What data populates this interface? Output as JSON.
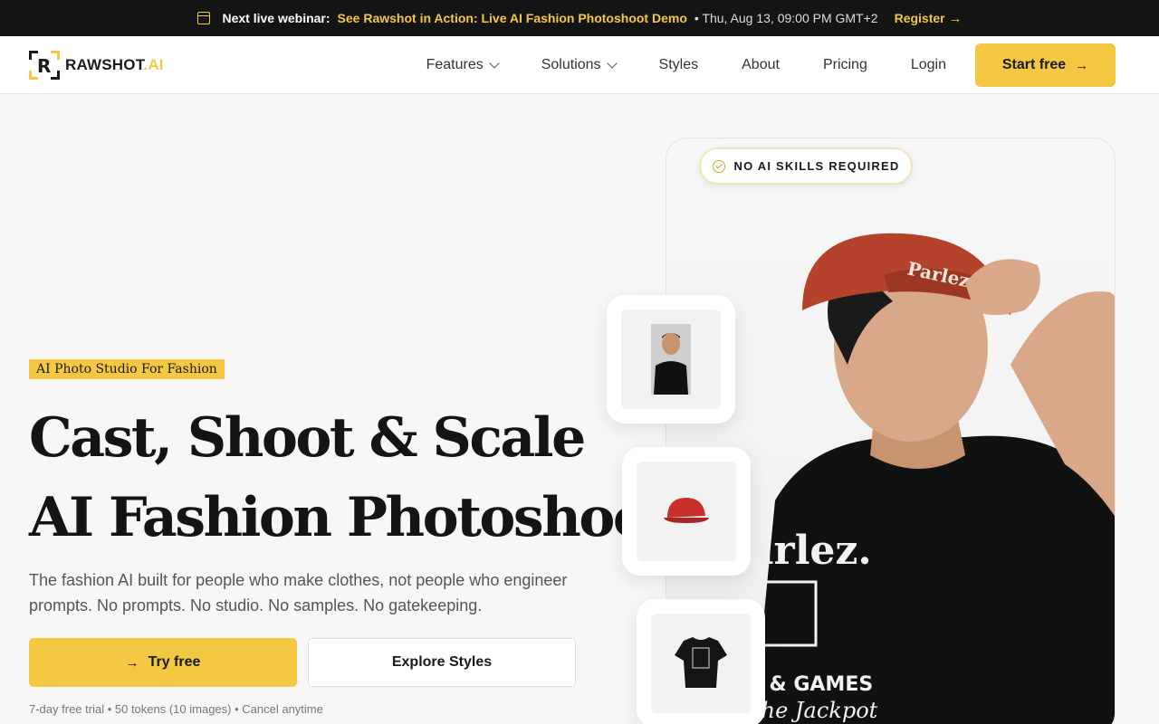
{
  "announcement": {
    "prefix": "Next live webinar:",
    "title": "See Rawshot in Action: Live AI Fashion Photoshoot Demo",
    "date": "• Thu, Aug 13, 09:00 PM GMT+2",
    "register": "Register"
  },
  "nav": {
    "logo_text": "RAWSHOT",
    "logo_suffix": ".AI",
    "items": [
      {
        "label": "Features",
        "dropdown": true
      },
      {
        "label": "Solutions",
        "dropdown": true
      },
      {
        "label": "Styles",
        "dropdown": false
      },
      {
        "label": "About",
        "dropdown": false
      },
      {
        "label": "Pricing",
        "dropdown": false
      },
      {
        "label": "Login",
        "dropdown": false
      }
    ],
    "cta": "Start free"
  },
  "hero": {
    "badge": "AI Photo Studio For Fashion",
    "title_line1": "Cast, Shoot & Scale",
    "title_line2": "AI Fashion Photoshoots",
    "subtitle": "The fashion AI built for people who make clothes, not people who engineer prompts. No prompts. No studio. No samples. No gatekeeping.",
    "primary_cta": "Try free",
    "secondary_cta": "Explore Styles",
    "fineprint": "7-day free trial • 50 tokens (10 images) • Cancel anytime",
    "pill": "NO AI SKILLS REQUIRED"
  },
  "colors": {
    "accent": "#f4c842",
    "dark": "#141414",
    "cap": "#b5432c"
  }
}
